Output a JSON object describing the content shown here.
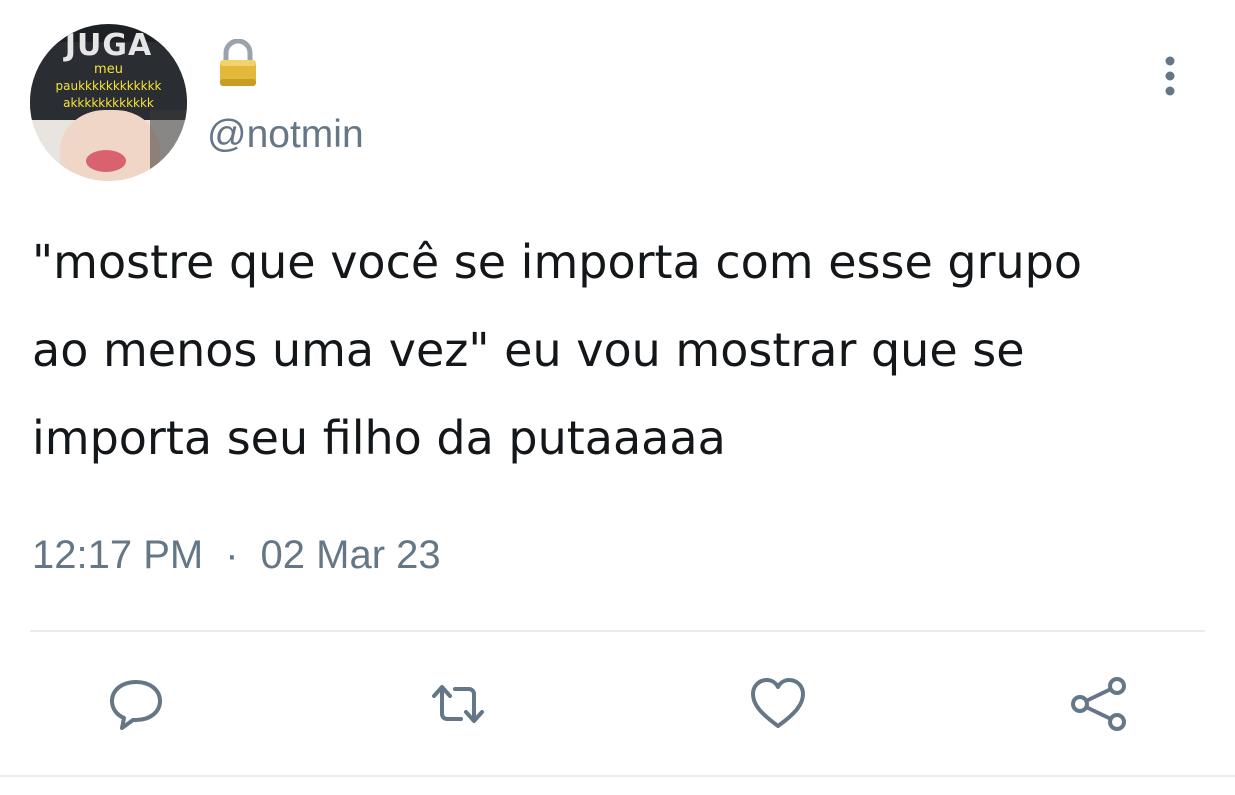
{
  "avatar": {
    "cap_text": "JUGA",
    "label_a": "meu",
    "label_b": "paukkkkkkkkkkkk",
    "label_c": "akkkkkkkkkkkk"
  },
  "user": {
    "handle": "@notmin",
    "protected": true
  },
  "tweet": {
    "text": "\"mostre que você se importa com esse grupo\nao menos uma vez\" eu vou mostrar que se\nimporta seu filho da putaaaaa",
    "time": "12:17 PM",
    "separator": "·",
    "date": "02 Mar 23"
  },
  "icons": {
    "lock": "lock-icon",
    "more": "more-vertical-icon",
    "reply": "reply-icon",
    "retweet": "retweet-icon",
    "like": "heart-icon",
    "share": "share-icon"
  },
  "colors": {
    "text": "#14171a",
    "secondary": "#657786",
    "divider": "#e6ecf0",
    "lock_gold": "#e2b93b"
  }
}
